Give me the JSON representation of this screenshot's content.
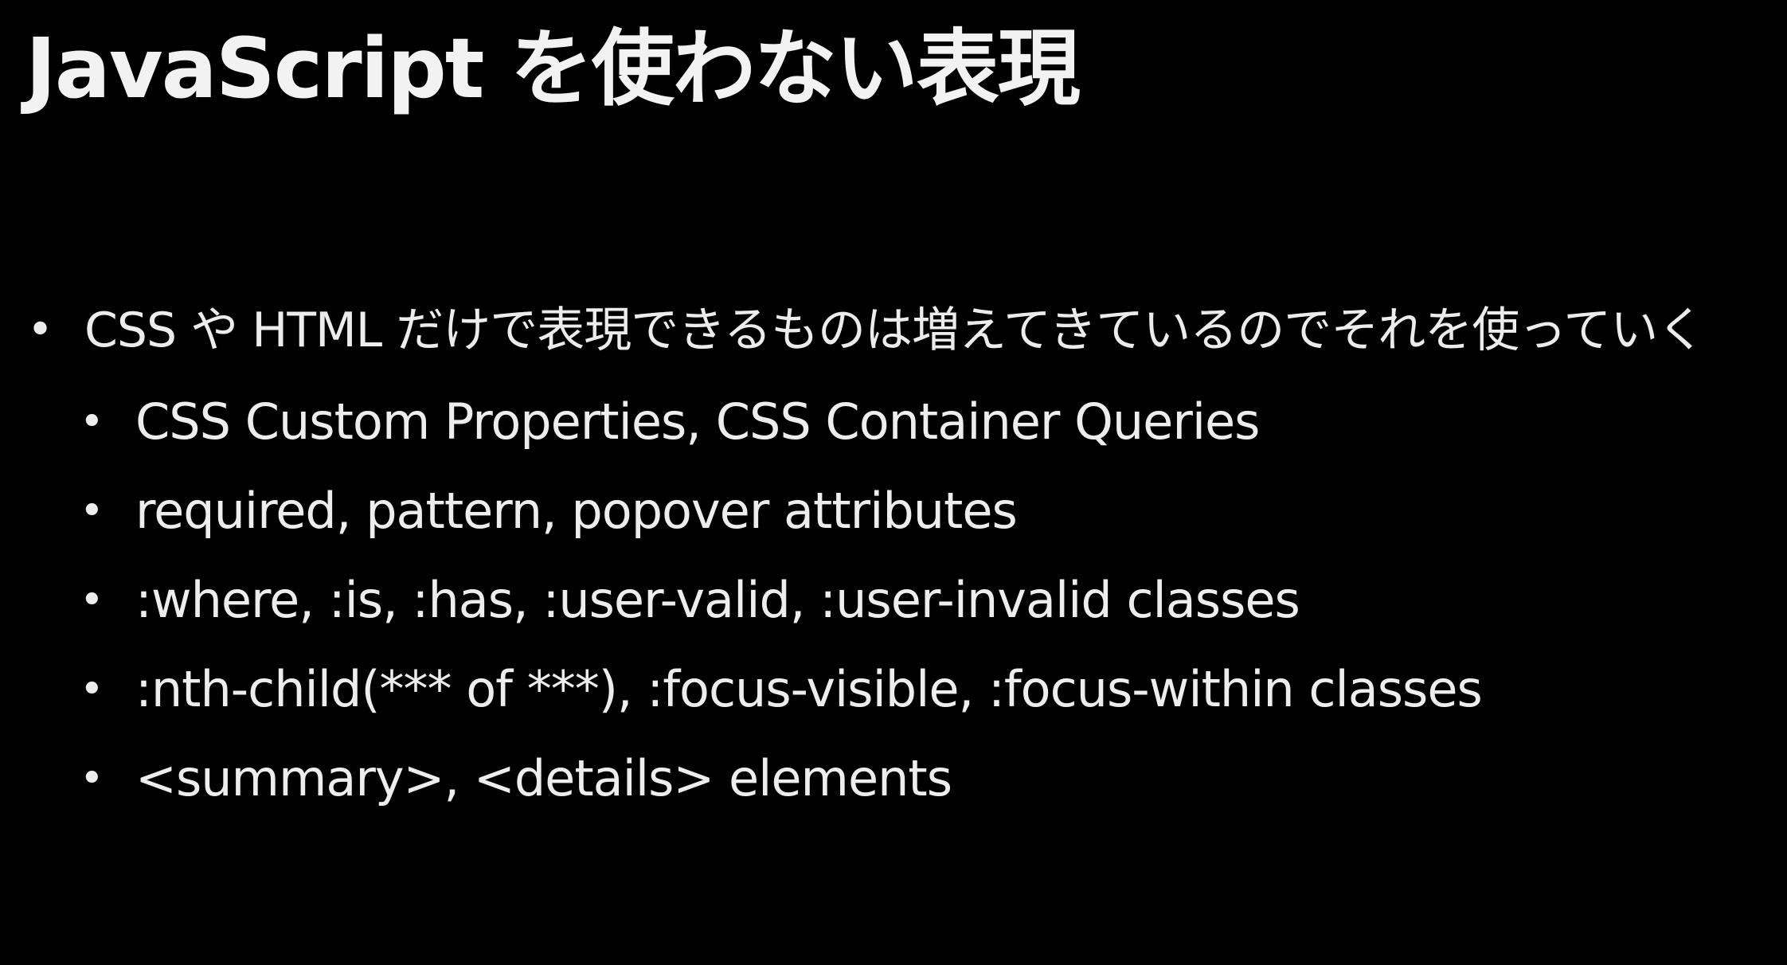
{
  "slide": {
    "title": "JavaScript を使わない表現",
    "bullet_main": "CSS や HTML だけで表現できるものは増えてきているのでそれを使っていく",
    "bullet_glyph": "•",
    "sub_bullets": [
      "CSS Custom Properties, CSS Container Queries",
      "required, pattern, popover attributes",
      ":where, :is, :has, :user-valid, :user-invalid classes",
      ":nth-child(*** of ***), :focus-visible, :focus-within classes",
      "<summary>, <details> elements"
    ]
  },
  "colors": {
    "background": "#000000",
    "text": "#ececec"
  }
}
